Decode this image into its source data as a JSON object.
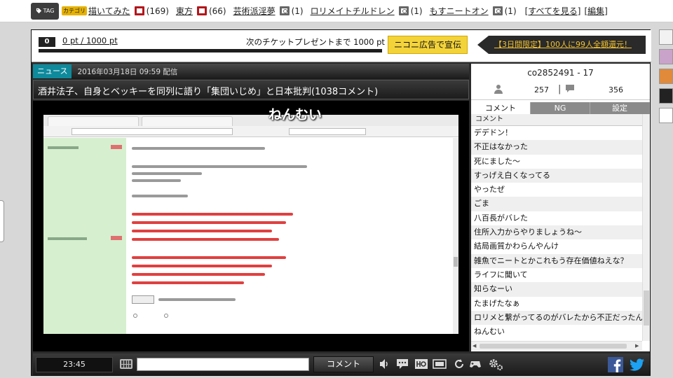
{
  "tagbar": {
    "tag_button_label": "TAG",
    "category_badge": "カテゴリ",
    "tags": [
      {
        "name": "描いてみた",
        "icon": "dic-red",
        "count": "(169)"
      },
      {
        "name": "東方",
        "icon": "dic-red",
        "count": "(66)"
      },
      {
        "name": "芸術派淫夢",
        "icon": "dic-gray",
        "count": "(1)"
      },
      {
        "name": "ロリメイトチルドレン",
        "icon": "dic-gray",
        "count": "(1)"
      },
      {
        "name": "もすニートオン",
        "icon": "dic-gray",
        "count": "(1)"
      }
    ],
    "see_all": "[すべてを見る]",
    "edit": "[編集]"
  },
  "ticket": {
    "count": "0",
    "points": "0 pt / 1000 pt",
    "progress": 0,
    "next_present": "次のチケットプレゼントまで 1000 pt",
    "ad_button": "ニコニ広告で宣伝",
    "campaign": "【3日間限定】100人に99人全額還元！"
  },
  "news": {
    "badge": "ニュース",
    "date": "2016年03月18日 09:59 配信",
    "title": "酒井法子、自身とベッキーを同列に語り「集団いじめ」と日本批判(1038コメント)"
  },
  "video": {
    "flow_comment": "ねんむい"
  },
  "controls": {
    "time": "23:45",
    "comment_button": "コメント"
  },
  "panel": {
    "video_id": "co2852491 - 17",
    "viewers": "257",
    "comments": "356",
    "tabs": [
      "コメント",
      "NG",
      "設定"
    ],
    "column_header": "コメント",
    "comment_rows": [
      "デデドン！",
      "不正はなかった",
      "死にました～",
      "すっげえ白くなってる",
      "やったぜ",
      "ごま",
      "八百長がバレた",
      "住所入力からやりましょうね～",
      "結局画質かわらんやんけ",
      "雑魚でニートとかこれもう存在価値ねえな？",
      "ライフに聞いて",
      "知らなーい",
      "たまげたなぁ",
      "ロリメと繋がってるのがバレたから不正だったんだろ",
      "ねんむい"
    ]
  },
  "colors": {
    "news_badge": "#0e8a9c",
    "ad_button": "#f3d33a",
    "campaign_text": "#f2c230",
    "facebook": "#3b5998",
    "twitter": "#1da1f2"
  }
}
